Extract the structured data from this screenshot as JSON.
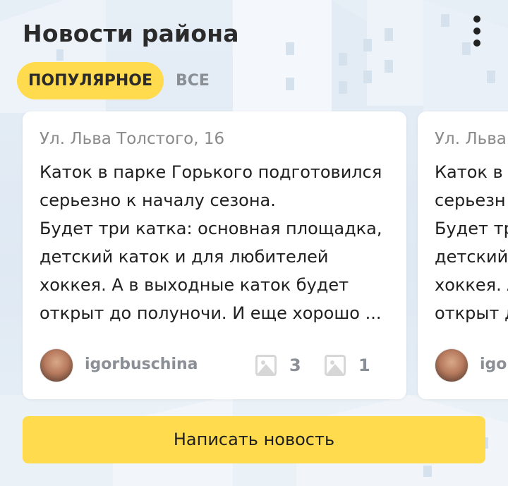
{
  "header": {
    "title": "Новости района",
    "menu_icon": "more-vertical-icon"
  },
  "tabs": [
    {
      "label": "ПОПУЛЯРНОЕ",
      "active": true
    },
    {
      "label": "ВСЕ",
      "active": false
    }
  ],
  "cards": [
    {
      "address": "Ул. Льва Толстого, 16",
      "text": "Каток в парке Горького подготовился серьезно к началу сезона.\nБудет три катка: основная площадка, детский каток и для любителей хоккея. А в выходные каток будет открыт до полуночи. И еще хорошо ...",
      "author": "igorbuschina",
      "stats": [
        {
          "icon": "image-icon",
          "count": "3"
        },
        {
          "icon": "image-icon",
          "count": "1"
        }
      ]
    },
    {
      "address": "Ул. Льва",
      "text": "Каток в\nсерьезн\nБудет тр\nдетский\nхоккея. А\nоткрыт д",
      "author": "igor"
    }
  ],
  "write_button": {
    "label": "Написать новость"
  },
  "colors": {
    "accent": "#ffdb4d",
    "background": "#e3ecf5",
    "muted_text": "#8a8f96"
  }
}
